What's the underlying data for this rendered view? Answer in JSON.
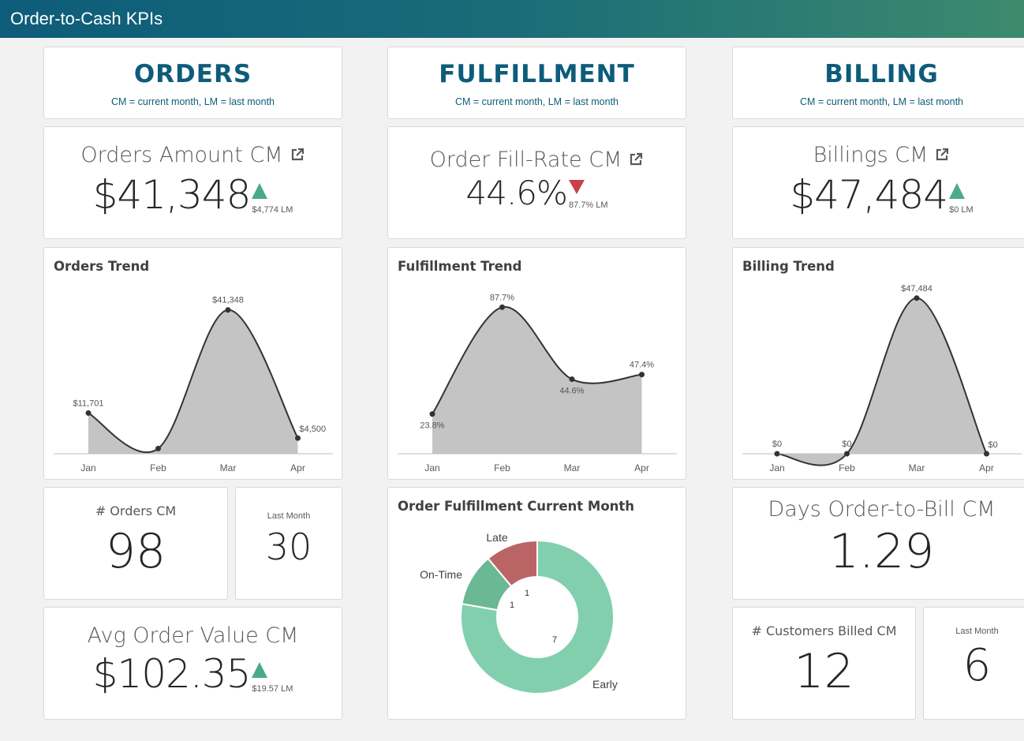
{
  "app": {
    "title": "Order-to-Cash KPIs"
  },
  "colors": {
    "accent": "#0d5c7a",
    "up": "#4aaa8a",
    "down": "#c8404a",
    "area": "#c4c4c4",
    "early": "#82cfae",
    "ontime": "#6ab894",
    "late": "#bb6466"
  },
  "sections": {
    "orders": {
      "title": "ORDERS",
      "subtitle": "CM = current month, LM = last month"
    },
    "fulfillment": {
      "title": "FULFILLMENT",
      "subtitle": "CM = current month, LM = last month"
    },
    "billing": {
      "title": "BILLING",
      "subtitle": "CM = current month, LM = last month"
    }
  },
  "kpis": {
    "orders_amount": {
      "title": "Orders Amount CM",
      "value": "$41,348",
      "lm": "$4,774 LM",
      "trend": "up"
    },
    "fill_rate": {
      "title": "Order Fill-Rate CM",
      "value": "44.6%",
      "lm": "87.7% LM",
      "trend": "down"
    },
    "billings": {
      "title": "Billings CM",
      "value": "$47,484",
      "lm": "$0 LM",
      "trend": "up"
    },
    "orders_count": {
      "title": "# Orders CM",
      "value": "98"
    },
    "orders_last_month": {
      "title": "Last Month",
      "value": "30"
    },
    "avg_order_value": {
      "title": "Avg Order Value CM",
      "value": "$102.35",
      "lm": "$19.57 LM",
      "trend": "up"
    },
    "days_order_to_bill": {
      "title": "Days Order-to-Bill CM",
      "value": "1.29"
    },
    "customers_billed": {
      "title": "# Customers Billed CM",
      "value": "12"
    },
    "customers_last_month": {
      "title": "Last Month",
      "value": "6"
    }
  },
  "chart_data": [
    {
      "type": "area",
      "title": "Orders Trend",
      "categories": [
        "Jan",
        "Feb",
        "Mar",
        "Apr"
      ],
      "values": [
        11701,
        1500,
        41348,
        4500
      ],
      "data_labels": [
        "$11,701",
        "",
        "$41,348",
        "$4,500"
      ],
      "ylim": [
        0,
        49000
      ],
      "grid": false
    },
    {
      "type": "area",
      "title": "Fulfillment Trend",
      "categories": [
        "Jan",
        "Feb",
        "Mar",
        "Apr"
      ],
      "values": [
        23.8,
        87.7,
        44.6,
        47.4
      ],
      "data_labels": [
        "23.8%",
        "87.7%",
        "44.6%",
        "47.4%"
      ],
      "ylim": [
        0,
        102
      ],
      "grid": false
    },
    {
      "type": "area",
      "title": "Billing Trend",
      "categories": [
        "Jan",
        "Feb",
        "Mar",
        "Apr"
      ],
      "values": [
        0,
        0,
        47484,
        0
      ],
      "data_labels": [
        "$0",
        "$0",
        "$47,484",
        "$0"
      ],
      "ylim": [
        0,
        52000
      ],
      "grid": false
    },
    {
      "type": "pie",
      "title": "Order Fulfillment Current Month",
      "labels": [
        "Early",
        "On-Time",
        "Late"
      ],
      "values": [
        7,
        1,
        1
      ]
    }
  ]
}
